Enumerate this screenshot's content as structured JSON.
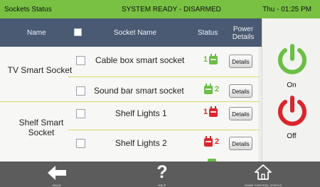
{
  "topbar": {
    "title": "Sockets Status",
    "system_status": "SYSTEM READY - DISARMED",
    "datetime": "Thu - 01:25 PM"
  },
  "table": {
    "columns": {
      "name": "Name",
      "socket_name": "Socket Name",
      "status": "Status",
      "power_details": "Power Details"
    },
    "groups": [
      {
        "name": "TV Smart Socket"
      },
      {
        "name": "Shelf Smart Socket"
      }
    ],
    "rows": [
      {
        "socket": "Cable box smart socket",
        "status_num": "1",
        "status": "on",
        "details": "Details"
      },
      {
        "socket": "Sound bar smart socket",
        "status_num": "2",
        "status": "on",
        "details": "Details"
      },
      {
        "socket": "Shelf Lights 1",
        "status_num": "1",
        "status": "off",
        "details": "Details"
      },
      {
        "socket": "Shelf Lights 2",
        "status_num": "2",
        "status": "off",
        "details": "Details"
      }
    ]
  },
  "power_panel": {
    "on_label": "On",
    "off_label": "Off",
    "on_color": "#6abf45",
    "off_color": "#d8262c"
  },
  "bottombar": {
    "back": "BACK",
    "help": "HELP",
    "home": "HOME CONTROL STATUS"
  },
  "colors": {
    "topbar": "#79c142",
    "header": "#4a5a72",
    "separator": "#d9d86a",
    "on": "#6abf45",
    "off": "#d8262c",
    "bottombar": "#5c5c5c"
  }
}
